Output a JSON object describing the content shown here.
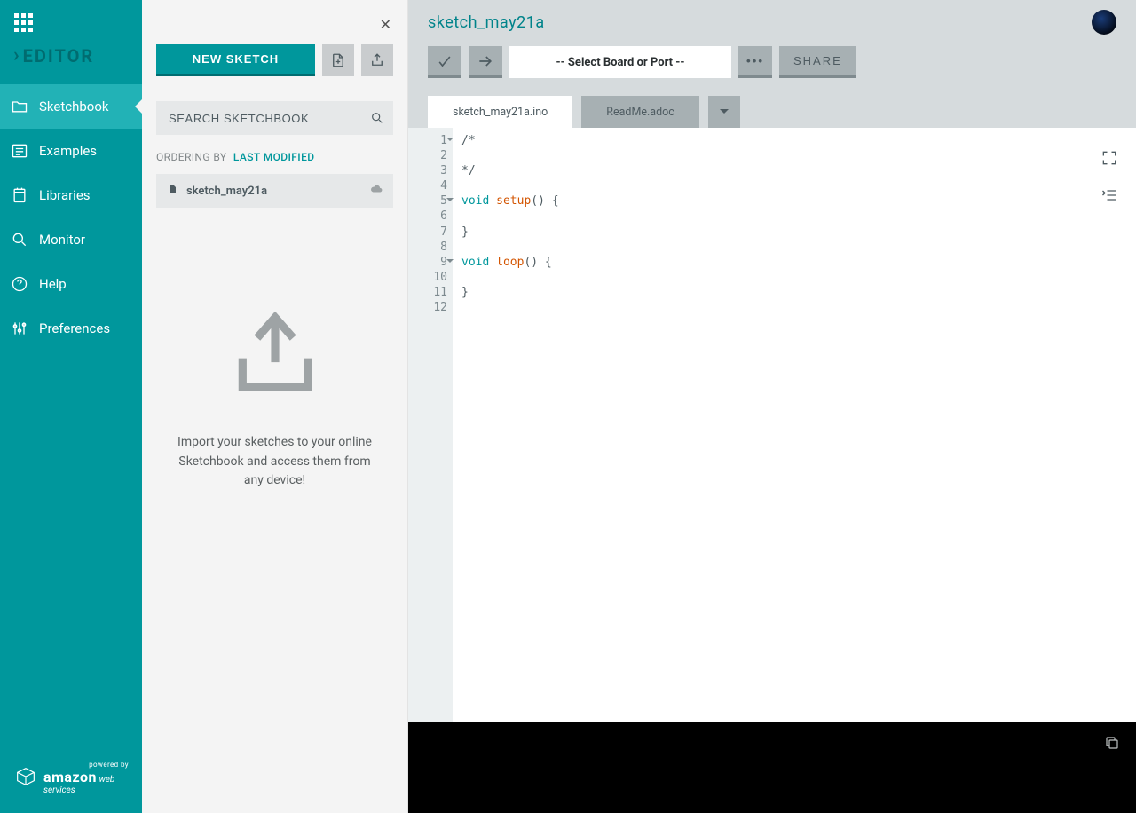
{
  "sidebar": {
    "title": "EDITOR",
    "nav": [
      {
        "label": "Sketchbook"
      },
      {
        "label": "Examples"
      },
      {
        "label": "Libraries"
      },
      {
        "label": "Monitor"
      },
      {
        "label": "Help"
      },
      {
        "label": "Preferences"
      }
    ],
    "powered": {
      "small": "powered by",
      "brand": "amazon",
      "sub": "web services"
    }
  },
  "panel": {
    "new_sketch": "NEW SKETCH",
    "search_placeholder": "SEARCH SKETCHBOOK",
    "ordering_label": "ORDERING BY",
    "ordering_value": "LAST MODIFIED",
    "sketch_item": "sketch_may21a",
    "import_text": "Import your sketches to your online Sketchbook and access them from any device!"
  },
  "header": {
    "sketch_name": "sketch_may21a",
    "board_placeholder": "-- Select Board or Port --",
    "share": "SHARE"
  },
  "tabs": [
    {
      "label": "sketch_may21a.ino",
      "active": true
    },
    {
      "label": "ReadMe.adoc",
      "active": false
    }
  ],
  "code": {
    "lines": [
      {
        "n": 1,
        "fold": true,
        "html": "/*"
      },
      {
        "n": 2,
        "fold": false,
        "html": ""
      },
      {
        "n": 3,
        "fold": false,
        "html": "*/"
      },
      {
        "n": 4,
        "fold": false,
        "html": ""
      },
      {
        "n": 5,
        "fold": true,
        "html": "<span class='kw'>void</span> <span class='fn'>setup</span>() {"
      },
      {
        "n": 6,
        "fold": false,
        "html": " "
      },
      {
        "n": 7,
        "fold": false,
        "html": "}"
      },
      {
        "n": 8,
        "fold": false,
        "html": ""
      },
      {
        "n": 9,
        "fold": true,
        "html": "<span class='kw'>void</span> <span class='fn'>loop</span>() {"
      },
      {
        "n": 10,
        "fold": false,
        "html": " "
      },
      {
        "n": 11,
        "fold": false,
        "html": "}"
      },
      {
        "n": 12,
        "fold": false,
        "html": ""
      }
    ]
  }
}
